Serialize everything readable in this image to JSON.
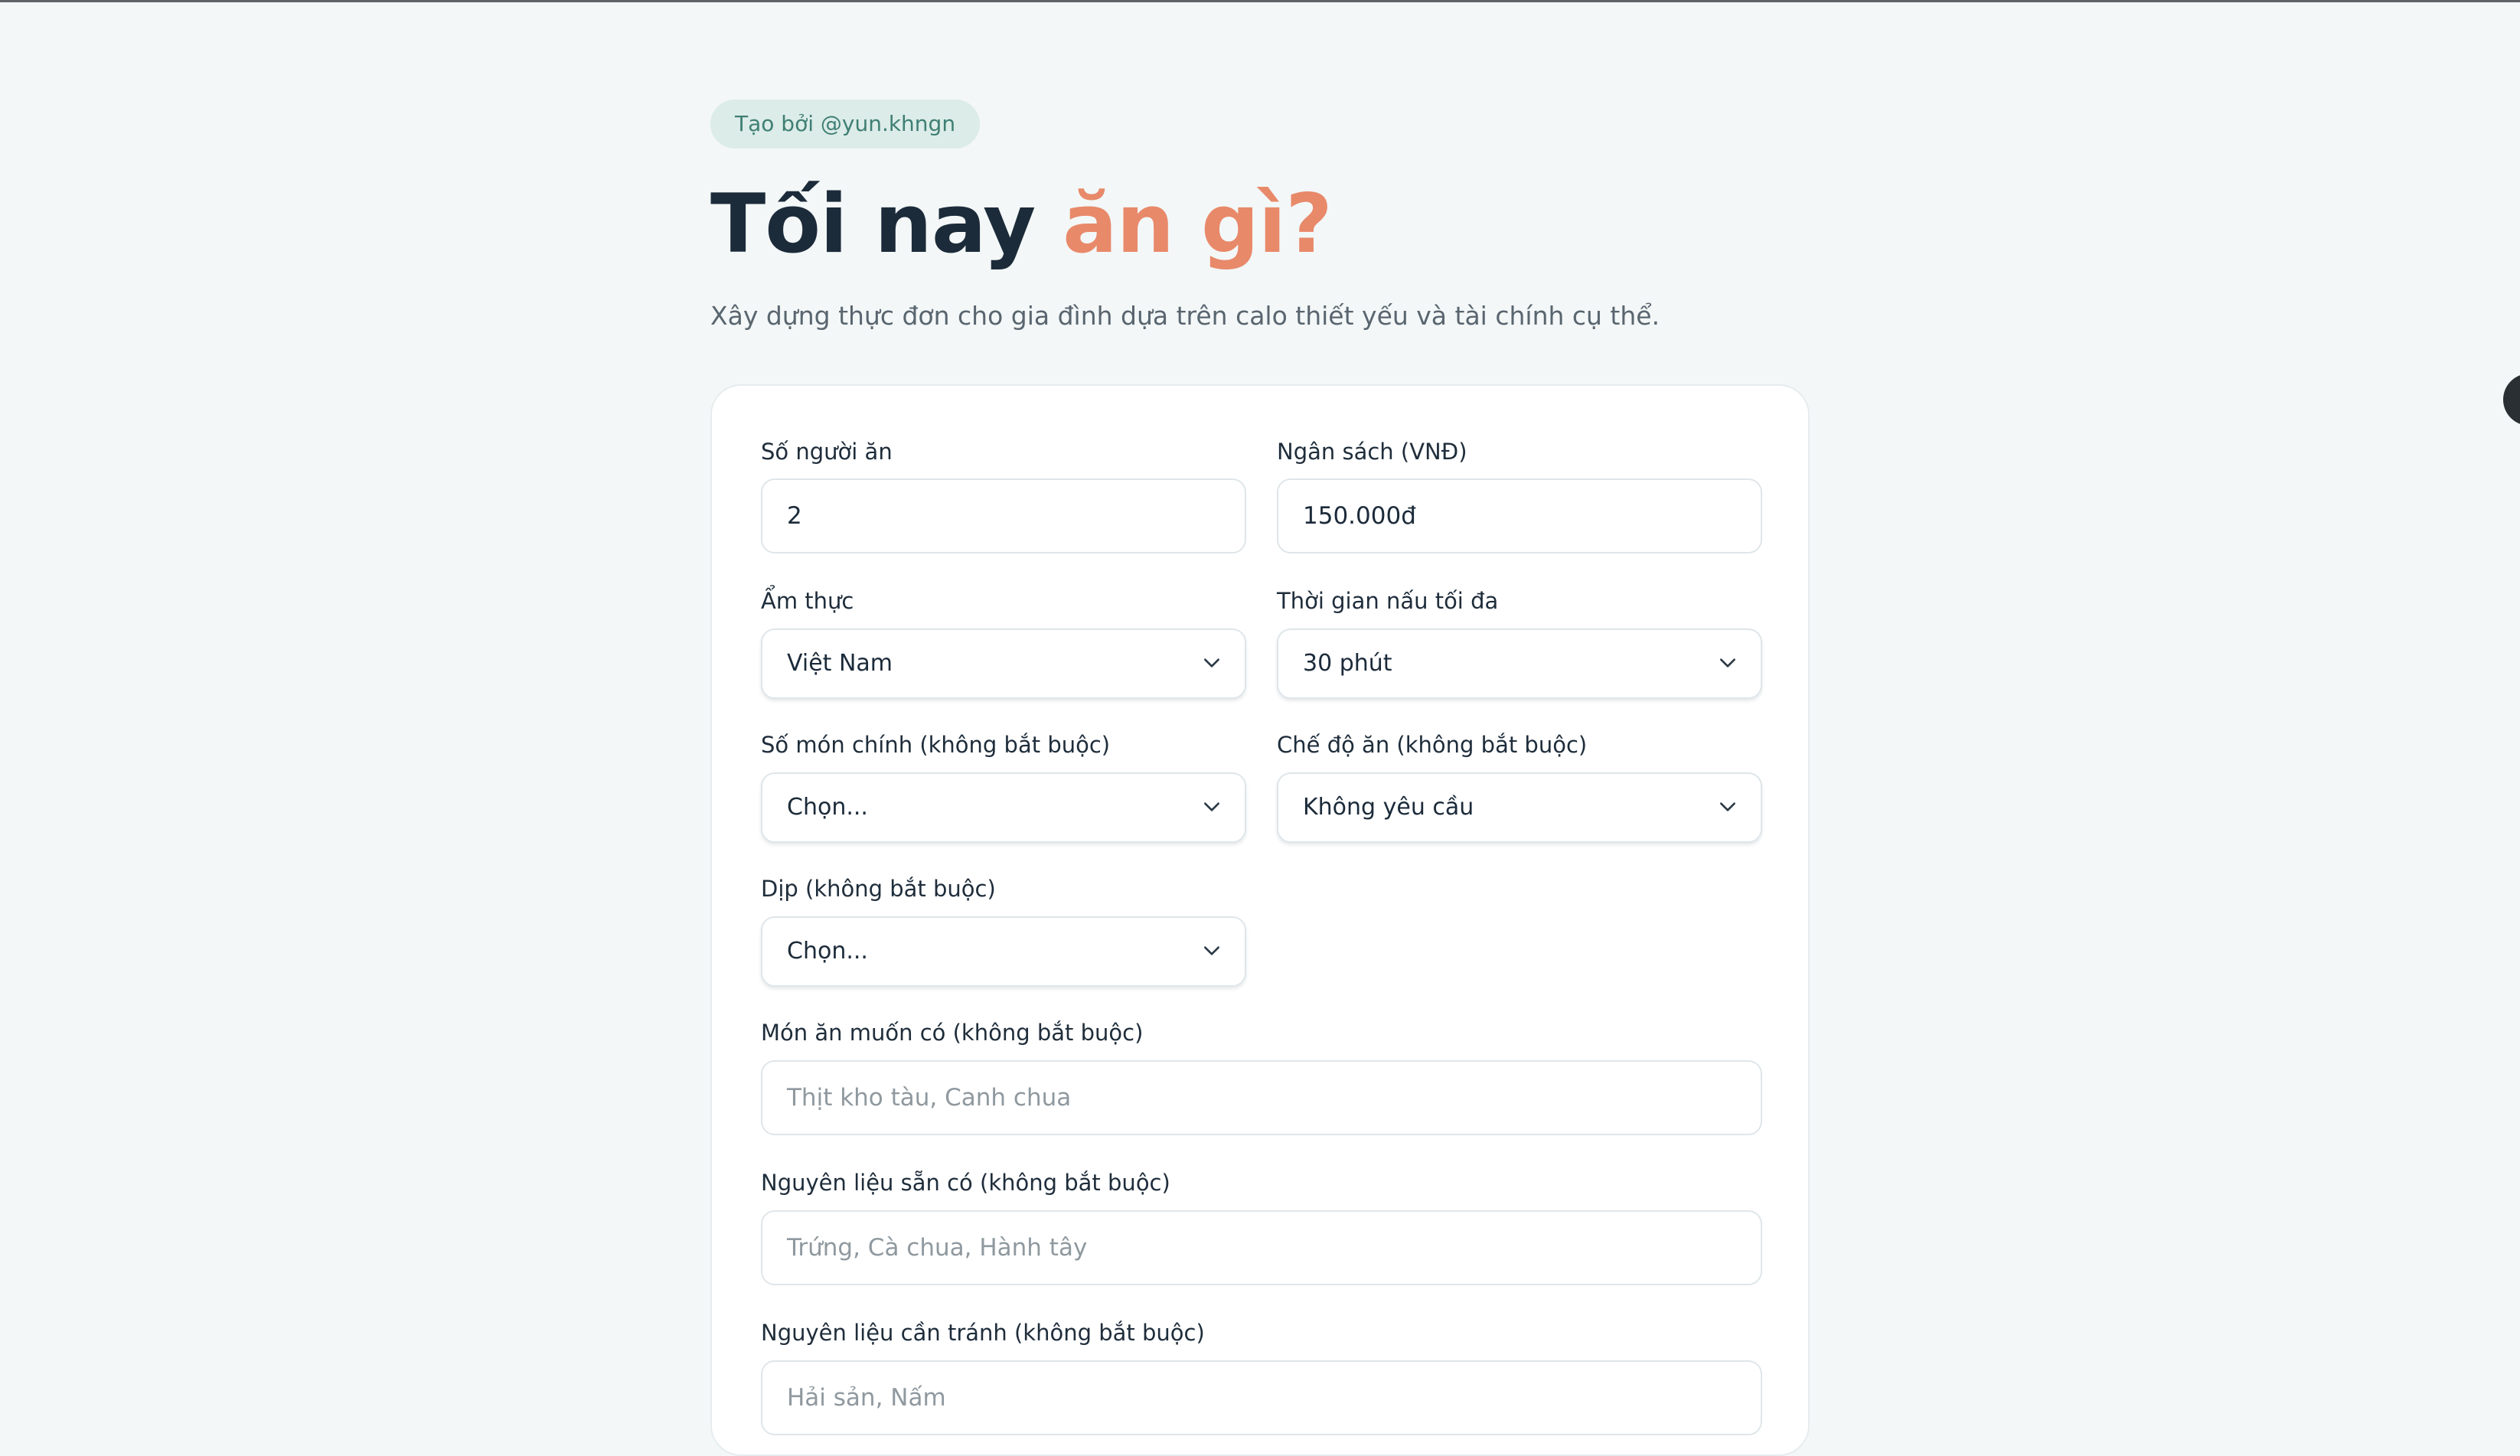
{
  "header": {
    "badge": "Tạo bởi @yun.khngn",
    "title_main": "Tối nay",
    "title_accent": "ăn gì?",
    "subtitle": "Xây dựng thực đơn cho gia đình dựa trên calo thiết yếu và tài chính cụ thể."
  },
  "form": {
    "people": {
      "label": "Số người ăn",
      "value": "2"
    },
    "budget": {
      "label": "Ngân sách (VNĐ)",
      "value": "150.000đ"
    },
    "cuisine": {
      "label": "Ẩm thực",
      "value": "Việt Nam"
    },
    "cook_time": {
      "label": "Thời gian nấu tối đa",
      "value": "30 phút"
    },
    "main_dishes": {
      "label": "Số món chính (không bắt buộc)",
      "value": "Chọn..."
    },
    "diet": {
      "label": "Chế độ ăn (không bắt buộc)",
      "value": "Không yêu cầu"
    },
    "occasion": {
      "label": "Dịp (không bắt buộc)",
      "value": "Chọn..."
    },
    "desired_dishes": {
      "label": "Món ăn muốn có (không bắt buộc)",
      "placeholder": "Thịt kho tàu, Canh chua"
    },
    "available_ingredients": {
      "label": "Nguyên liệu sẵn có (không bắt buộc)",
      "placeholder": "Trứng, Cà chua, Hành tây"
    },
    "avoid_ingredients": {
      "label": "Nguyên liệu cần tránh (không bắt buộc)",
      "placeholder": "Hải sản, Nấm"
    }
  },
  "icons": {
    "dropdown": "chevron-down-icon"
  },
  "colors": {
    "accent": "#e8896a",
    "badge_bg": "#dcece8",
    "badge_text": "#3f7f74",
    "page_bg": "#f3f7f7",
    "title": "#1c2b3a"
  }
}
